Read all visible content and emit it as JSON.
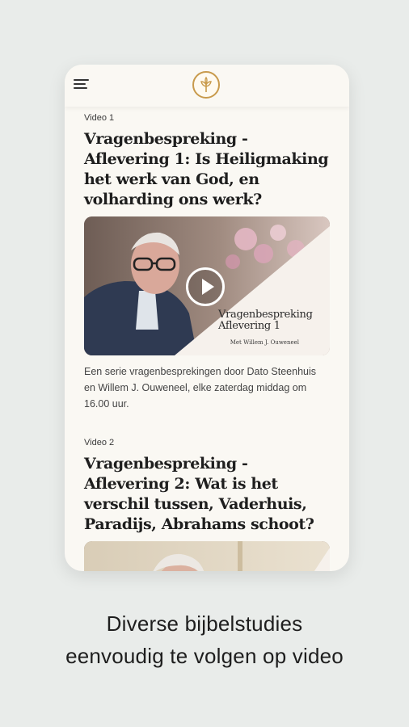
{
  "app": {
    "logo": "tree-logo-icon",
    "menu_icon": "hamburger-menu-icon",
    "accent": "#c89a4c"
  },
  "videos": [
    {
      "label": "Video 1",
      "title": "Vragenbespreking - Aflevering 1: Is Heiligmaking het werk van God, en volharding ons werk?",
      "thumb_title_line1": "Vragenbespreking",
      "thumb_title_line2": "Aflevering 1",
      "thumb_subtitle": "Met Willem J. Ouweneel",
      "description": "Een serie vragenbesprekingen door Dato Steenhuis en Willem J. Ouweneel, elke zaterdag middag om 16.00 uur."
    },
    {
      "label": "Video 2",
      "title": "Vragenbespreking - Aflevering 2: Wat is het verschil tussen, Vaderhuis, Paradijs, Abrahams schoot?"
    }
  ],
  "caption": {
    "line1": "Diverse bijbelstudies",
    "line2": "eenvoudig te volgen op video"
  }
}
